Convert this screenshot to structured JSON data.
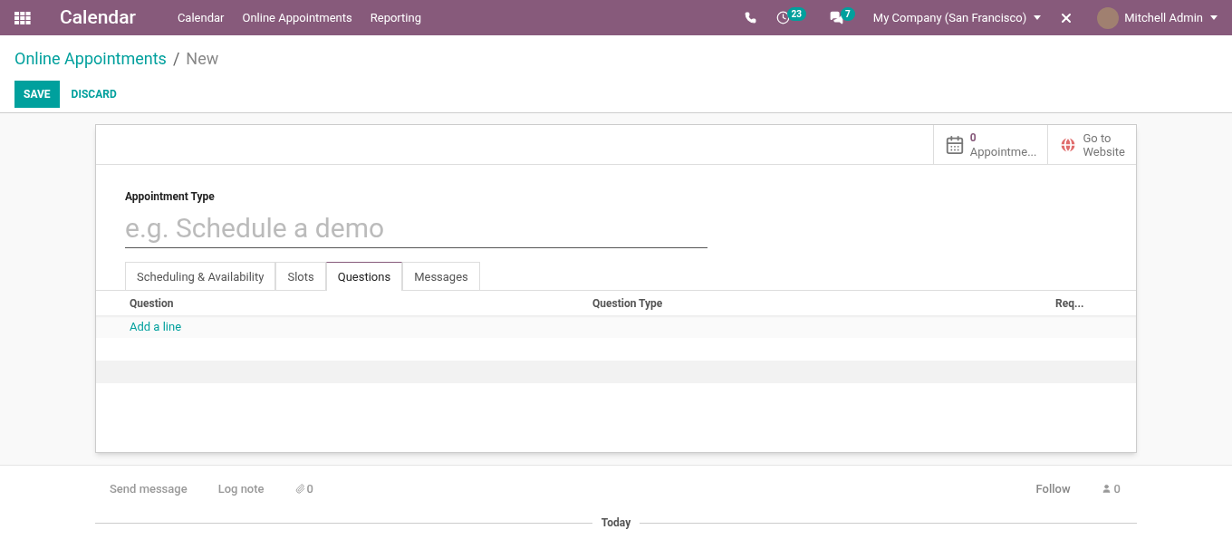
{
  "navbar": {
    "app_title": "Calendar",
    "menu": [
      "Calendar",
      "Online Appointments",
      "Reporting"
    ],
    "activity_count": "23",
    "message_count": "7",
    "company": "My Company (San Francisco)",
    "user": "Mitchell Admin"
  },
  "breadcrumb": {
    "parent": "Online Appointments",
    "separator": "/",
    "current": "New"
  },
  "actions": {
    "save": "SAVE",
    "discard": "DISCARD"
  },
  "smart_buttons": [
    {
      "kind": "appointments",
      "value": "0",
      "label": "Appointme..."
    },
    {
      "kind": "website",
      "value": "Go to",
      "label": "Website"
    }
  ],
  "form": {
    "field_label": "Appointment Type",
    "placeholder": "e.g. Schedule a demo"
  },
  "tabs": [
    {
      "label": "Scheduling & Availability",
      "selected": false
    },
    {
      "label": "Slots",
      "selected": false
    },
    {
      "label": "Questions",
      "selected": true
    },
    {
      "label": "Messages",
      "selected": false
    }
  ],
  "table": {
    "columns": [
      "Question",
      "Question Type",
      "Req..."
    ],
    "add_line": "Add a line"
  },
  "chatter": {
    "send_message": "Send message",
    "log_note": "Log note",
    "attachments": "0",
    "follow": "Follow",
    "followers": "0",
    "divider": "Today"
  }
}
